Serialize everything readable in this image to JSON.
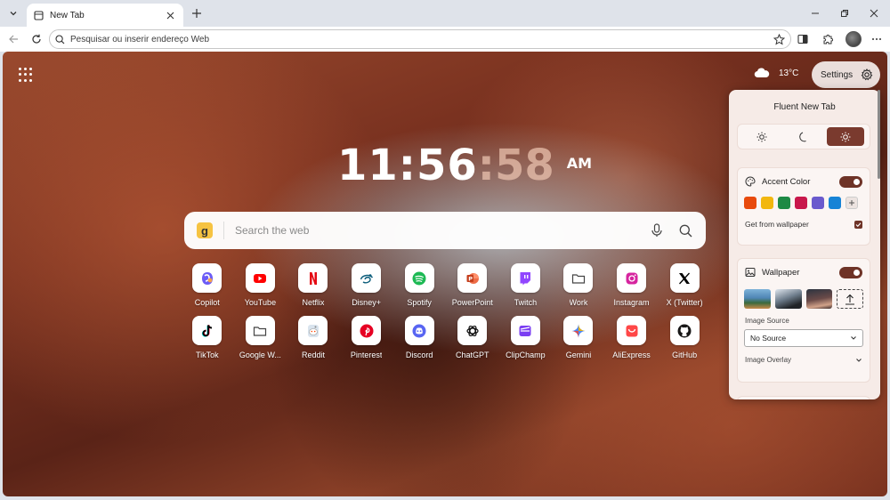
{
  "browser": {
    "tab_title": "New Tab",
    "address_placeholder": "Pesquisar ou inserir endereço Web"
  },
  "weather": {
    "temperature": "13°C",
    "icon": "cloud-icon"
  },
  "settings_button": {
    "label": "Settings"
  },
  "clock": {
    "hours_minutes": "11:56",
    "seconds": ":58",
    "ampm": "AM"
  },
  "search": {
    "placeholder": "Search the web",
    "engine_letter": "g"
  },
  "shortcuts": [
    {
      "name": "Copilot",
      "icon": "copilot-icon",
      "color": "#6b5cf6"
    },
    {
      "name": "YouTube",
      "icon": "youtube-icon",
      "color": "#ff0000"
    },
    {
      "name": "Netflix",
      "icon": "netflix-icon",
      "color": "#e50914"
    },
    {
      "name": "Disney+",
      "icon": "disney-icon",
      "color": "#0a5c7a"
    },
    {
      "name": "Spotify",
      "icon": "spotify-icon",
      "color": "#1db954"
    },
    {
      "name": "PowerPoint",
      "icon": "powerpoint-icon",
      "color": "#c43e1c"
    },
    {
      "name": "Twitch",
      "icon": "twitch-icon",
      "color": "#9146ff"
    },
    {
      "name": "Work",
      "icon": "folder-icon",
      "color": "#444444"
    },
    {
      "name": "Instagram",
      "icon": "instagram-icon",
      "color": "#d6249f"
    },
    {
      "name": "X (Twitter)",
      "icon": "x-icon",
      "color": "#000000"
    },
    {
      "name": "TikTok",
      "icon": "tiktok-icon",
      "color": "#000000"
    },
    {
      "name": "Google W...",
      "icon": "folder-icon",
      "color": "#444444"
    },
    {
      "name": "Reddit",
      "icon": "reddit-icon",
      "color": "#ff4500"
    },
    {
      "name": "Pinterest",
      "icon": "pinterest-icon",
      "color": "#e60023"
    },
    {
      "name": "Discord",
      "icon": "discord-icon",
      "color": "#5865f2"
    },
    {
      "name": "ChatGPT",
      "icon": "chatgpt-icon",
      "color": "#111111"
    },
    {
      "name": "ClipChamp",
      "icon": "clipchamp-icon",
      "color": "#7b3ff2"
    },
    {
      "name": "Gemini",
      "icon": "gemini-icon",
      "color": "#4f8af7"
    },
    {
      "name": "AliExpress",
      "icon": "aliexpress-icon",
      "color": "#ff4747"
    },
    {
      "name": "GitHub",
      "icon": "github-icon",
      "color": "#181717"
    }
  ],
  "panel": {
    "title": "Fluent New Tab",
    "accent": {
      "label": "Accent Color",
      "colors": [
        "#e84a0c",
        "#f2b70f",
        "#1e8a45",
        "#c8174b",
        "#6a5acd",
        "#1683d6"
      ],
      "get_from_wallpaper": "Get from wallpaper"
    },
    "wallpaper": {
      "label": "Wallpaper",
      "image_source_label": "Image Source",
      "image_source_value": "No Source",
      "image_overlay_label": "Image Overlay"
    }
  }
}
